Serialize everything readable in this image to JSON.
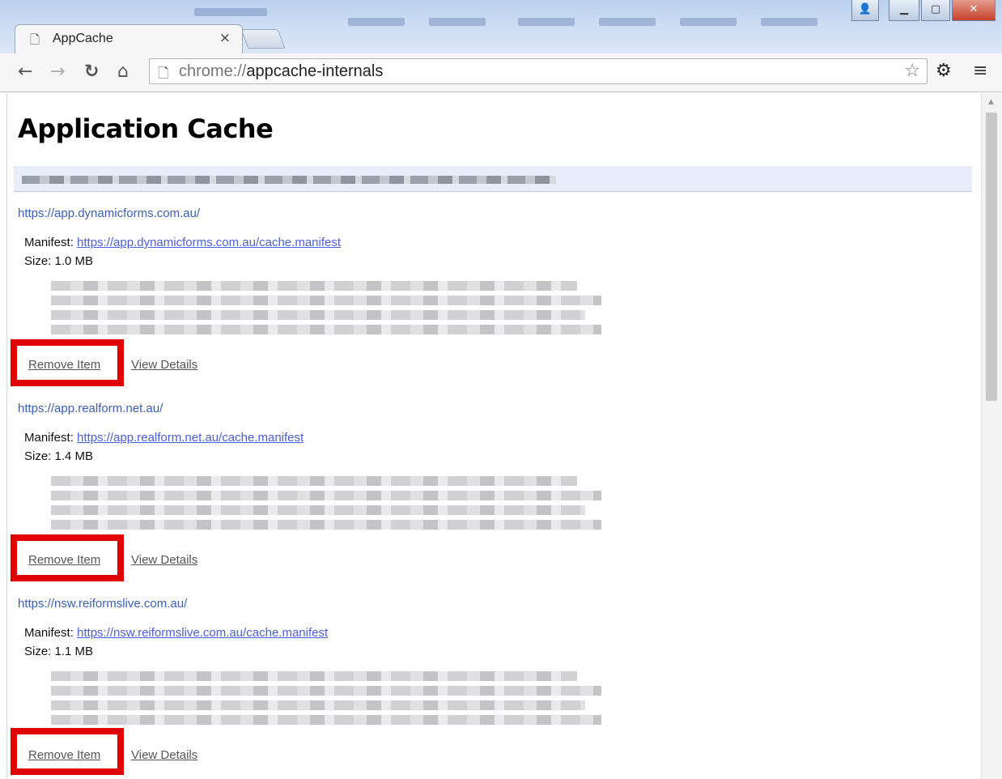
{
  "browser": {
    "tab_title": "AppCache",
    "tab_close": "×",
    "url_scheme": "chrome://",
    "url_path": "appcache-internals"
  },
  "page": {
    "title": "Application Cache"
  },
  "entries": [
    {
      "origin": "https://app.dynamicforms.com.au/",
      "manifest_label": "Manifest:",
      "manifest_url": "https://app.dynamicforms.com.au/cache.manifest",
      "size_text": "Size: 1.0 MB",
      "remove_label": "Remove Item",
      "details_label": "View Details"
    },
    {
      "origin": "https://app.realform.net.au/",
      "manifest_label": "Manifest:",
      "manifest_url": "https://app.realform.net.au/cache.manifest",
      "size_text": "Size: 1.4 MB",
      "remove_label": "Remove Item",
      "details_label": "View Details"
    },
    {
      "origin": "https://nsw.reiformslive.com.au/",
      "manifest_label": "Manifest:",
      "manifest_url": "https://nsw.reiformslive.com.au/cache.manifest",
      "size_text": "Size: 1.1 MB",
      "remove_label": "Remove Item",
      "details_label": "View Details"
    }
  ],
  "colors": {
    "highlight": "#e10000",
    "link": "#4b5ee0",
    "origin": "#3b5fbf"
  },
  "icons": [
    "page-icon",
    "close-icon",
    "back-arrow-icon",
    "forward-arrow-icon",
    "reload-icon",
    "home-icon",
    "star-icon",
    "gear-icon",
    "menu-icon"
  ]
}
